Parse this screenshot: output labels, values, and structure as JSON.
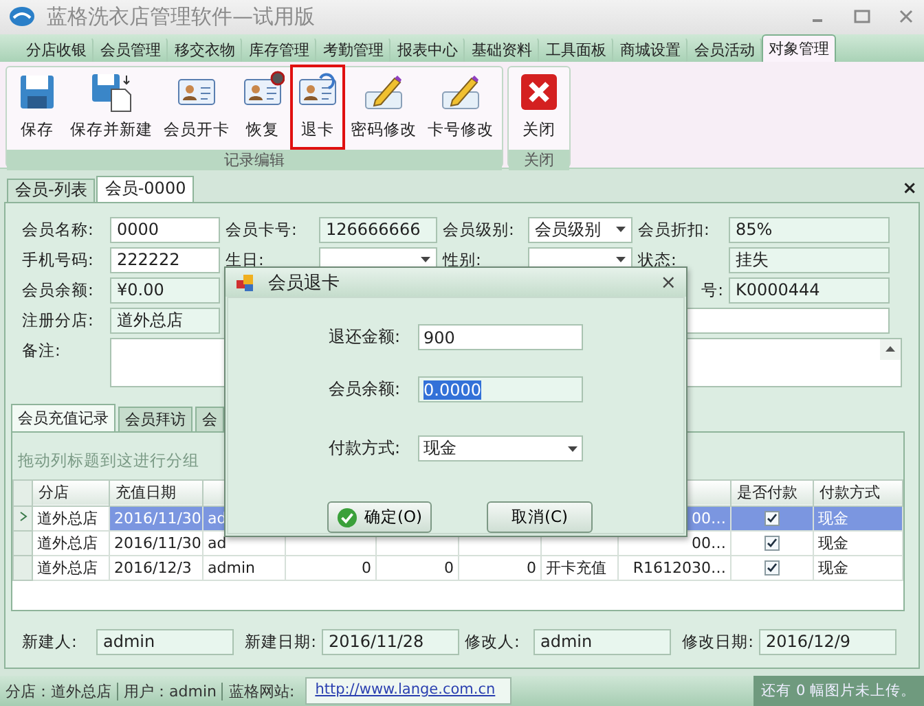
{
  "window": {
    "title": "蓝格洗衣店管理软件—试用版"
  },
  "menu_tabs": [
    {
      "label": "分店收银",
      "selected": false
    },
    {
      "label": "会员管理",
      "selected": false
    },
    {
      "label": "移交衣物",
      "selected": false
    },
    {
      "label": "库存管理",
      "selected": false
    },
    {
      "label": "考勤管理",
      "selected": false
    },
    {
      "label": "报表中心",
      "selected": false
    },
    {
      "label": "基础资料",
      "selected": false
    },
    {
      "label": "工具面板",
      "selected": false
    },
    {
      "label": "商城设置",
      "selected": false
    },
    {
      "label": "会员活动",
      "selected": false
    },
    {
      "label": "对象管理",
      "selected": true
    }
  ],
  "ribbon_groups": [
    {
      "label": "记录编辑",
      "buttons": [
        {
          "label": "保存",
          "kind": "save",
          "highlighted": false
        },
        {
          "label": "保存并新建",
          "kind": "save_new",
          "highlighted": false
        },
        {
          "label": "会员开卡",
          "kind": "card",
          "highlighted": false
        },
        {
          "label": "恢复",
          "kind": "card_badge",
          "highlighted": false
        },
        {
          "label": "退卡",
          "kind": "card_arrow",
          "highlighted": true
        },
        {
          "label": "密码修改",
          "kind": "pencil",
          "highlighted": false
        },
        {
          "label": "卡号修改",
          "kind": "pencil",
          "highlighted": false
        }
      ]
    },
    {
      "label": "关闭",
      "buttons": [
        {
          "label": "关闭",
          "kind": "close",
          "highlighted": false
        }
      ]
    }
  ],
  "doc_tabs": [
    {
      "label": "会员-列表",
      "selected": false
    },
    {
      "label": "会员-0000",
      "selected": true
    }
  ],
  "doc_close": "×",
  "form_rows": [
    [
      {
        "kind": "input",
        "label": "会员名称:",
        "value": "0000"
      },
      {
        "kind": "readonly",
        "label": "会员卡号:",
        "value": "126666666"
      },
      {
        "kind": "dropdown",
        "label": "会员级别:",
        "value": "会员级别"
      },
      {
        "kind": "readonly",
        "label": "会员折扣:",
        "value": "85%"
      }
    ],
    [
      {
        "kind": "input",
        "label": "手机号码:",
        "value": "222222"
      },
      {
        "kind": "dropdown",
        "label": "生日:"
      },
      {
        "kind": "dropdown",
        "label": "性别:"
      },
      {
        "kind": "readonly",
        "label": "状态:",
        "value": "挂失"
      }
    ],
    [
      {
        "kind": "readonly",
        "label": "会员余额:",
        "value": "¥0.00"
      },
      {
        "kind": "covered"
      },
      {
        "kind": "covered"
      },
      {
        "kind": "readonly",
        "label": "号:",
        "value": "K0000444"
      }
    ],
    [
      {
        "kind": "readonly",
        "label": "注册分店:",
        "value": "道外总店"
      },
      {
        "kind": "covered"
      },
      {
        "kind": "wide"
      }
    ]
  ],
  "remark": {
    "label": "备注:"
  },
  "sub_tabs": [
    {
      "label": "会员充值记录",
      "selected": true
    },
    {
      "label": "会员拜访",
      "selected": false
    },
    {
      "label": "会",
      "selected": false
    }
  ],
  "grid": {
    "group_hint": "拖动列标题到这进行分组",
    "columns": [
      {
        "label": "分店"
      },
      {
        "label": "充值日期"
      },
      {},
      {},
      {},
      {},
      {},
      {},
      {
        "label": "是否付款"
      },
      {
        "label": "付款方式"
      }
    ],
    "rows": [
      {
        "selected": true,
        "branch": "道外总店",
        "date": "2016/11/30",
        "column_3": "ad",
        "column_8": "00…",
        "paid": true,
        "payment": "现金"
      },
      {
        "selected": false,
        "branch": "道外总店",
        "date": "2016/11/30",
        "column_3": "ad",
        "column_8": "00…",
        "paid": true,
        "payment": "现金"
      },
      {
        "selected": false,
        "branch": "道外总店",
        "date": "2016/12/3",
        "column_3": "admin",
        "column_4": "0",
        "column_5": "0",
        "column_6": "0",
        "column_7": "开卡充值",
        "column_8": "R1612030…",
        "paid": true,
        "payment": "现金"
      }
    ]
  },
  "footer_fields": [
    {
      "label": "新建人:",
      "value": "admin"
    },
    {
      "label": "新建日期:",
      "value": "2016/11/28"
    },
    {
      "label": "修改人:",
      "value": "admin"
    },
    {
      "label": "修改日期:",
      "value": "2016/12/9"
    }
  ],
  "status_bar": {
    "branch": "分店：道外总店",
    "user": "用户：admin",
    "site_label": "蓝格网站:",
    "site_link": "http://www.lange.com.cn",
    "upload_note": "还有 0 幅图片未上传。"
  },
  "dialog": {
    "title": "会员退卡",
    "close": "×",
    "fields": [
      {
        "kind": "input",
        "label": "退还金额:",
        "value": "900",
        "text_selected": false
      },
      {
        "kind": "readonly",
        "label": "会员余额:",
        "value": "0.0000",
        "text_selected": true
      },
      {
        "kind": "dropdown",
        "label": "付款方式:",
        "value": "现金",
        "text_selected": false
      }
    ],
    "buttons": [
      {
        "label": "确定(O)",
        "kind": "ok"
      },
      {
        "label": "取消(C)",
        "kind": "cancel"
      }
    ]
  }
}
